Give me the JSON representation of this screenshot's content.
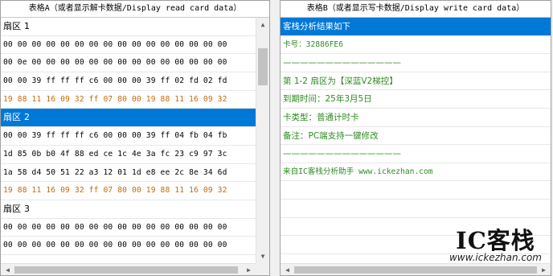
{
  "tableA": {
    "header": "表格A（或者显示解卡数据/Display read card data）",
    "rows": [
      {
        "text": "扇区 1",
        "kind": "sector"
      },
      {
        "text": "00 00 00 00 00 00 00 00 00 00 00 00 00 00 00 00",
        "kind": "data"
      },
      {
        "text": "00 0e 00 00 00 00 00 00 00 00 00 00 00 00 00 00",
        "kind": "data"
      },
      {
        "text": "00 00 39 ff ff ff c6 00 00 00 39 ff 02 fd 02 fd",
        "kind": "data"
      },
      {
        "text": "19 88 11 16 09 32 ff 07 80 00 19 88 11 16 09 32",
        "kind": "key"
      },
      {
        "text": "扇区 2",
        "kind": "sector-selected"
      },
      {
        "text": "00 00 39 ff ff ff c6 00 00 00 39 ff 04 fb 04 fb",
        "kind": "data"
      },
      {
        "text": "1d 85 0b b0 4f 88 ed ce 1c 4e 3a fc 23 c9 97 3c",
        "kind": "data"
      },
      {
        "text": "1a 58 d4 50 51 22 a3 12 01 1d e8 ee 2c 8e 34 6d",
        "kind": "data"
      },
      {
        "text": "19 88 11 16 09 32 ff 07 80 00 19 88 11 16 09 32",
        "kind": "key"
      },
      {
        "text": "扇区 3",
        "kind": "sector"
      },
      {
        "text": "00 00 00 00 00 00 00 00 00 00 00 00 00 00 00 00",
        "kind": "data"
      },
      {
        "text": "00 00 00 00 00 00 00 00 00 00 00 00 00 00 00 00",
        "kind": "data"
      }
    ]
  },
  "tableB": {
    "header": "表格B（或者显示写卡数据/Display write card data）",
    "rows": [
      {
        "text": "客栈分析结果如下",
        "kind": "selected"
      },
      {
        "text": "卡号：32886FE6",
        "kind": "text"
      },
      {
        "text": "——————————————",
        "kind": "text"
      },
      {
        "text": "第 1-2 扇区为【深蓝V2梯控】",
        "kind": "text"
      },
      {
        "text": "到期时间：25年3月5日",
        "kind": "text"
      },
      {
        "text": "卡类型：普通计时卡",
        "kind": "text"
      },
      {
        "text": "备注：PC端支持一键修改",
        "kind": "text"
      },
      {
        "text": "——————————————",
        "kind": "text"
      },
      {
        "text": "来自IC客栈分析助手 www.ickezhan.com",
        "kind": "text"
      },
      {
        "text": "",
        "kind": "text"
      },
      {
        "text": "",
        "kind": "text"
      },
      {
        "text": "",
        "kind": "text"
      },
      {
        "text": "",
        "kind": "text"
      }
    ]
  },
  "watermark": {
    "logo": "IC客栈",
    "url": "www.ickezhan.com"
  },
  "icons": {
    "up": "scroll-up-arrow",
    "down": "scroll-down-arrow",
    "left": "scroll-left-arrow",
    "right": "scroll-right-arrow"
  }
}
